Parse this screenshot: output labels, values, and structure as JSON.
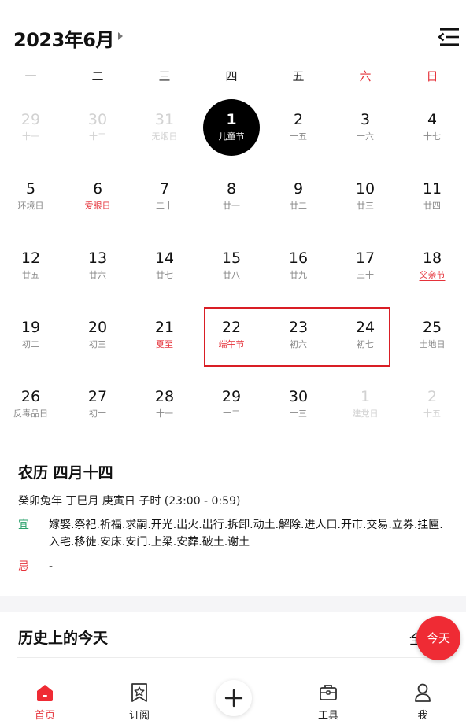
{
  "header": {
    "title": "2023年6月",
    "menu_icon": "collapse-menu-icon"
  },
  "weekdays": [
    {
      "label": "一",
      "weekend": false
    },
    {
      "label": "二",
      "weekend": false
    },
    {
      "label": "三",
      "weekend": false
    },
    {
      "label": "四",
      "weekend": false
    },
    {
      "label": "五",
      "weekend": false
    },
    {
      "label": "六",
      "weekend": true
    },
    {
      "label": "日",
      "weekend": true
    }
  ],
  "calendar": {
    "rows": [
      [
        {
          "day": "29",
          "sub": "十一",
          "dim": true
        },
        {
          "day": "30",
          "sub": "十二",
          "dim": true
        },
        {
          "day": "31",
          "sub": "无烟日",
          "dim": true
        },
        {
          "day": "1",
          "sub": "儿童节",
          "today": true
        },
        {
          "day": "2",
          "sub": "十五"
        },
        {
          "day": "3",
          "sub": "十六"
        },
        {
          "day": "4",
          "sub": "十七"
        }
      ],
      [
        {
          "day": "5",
          "sub": "环境日"
        },
        {
          "day": "6",
          "sub": "爱眼日",
          "red": true
        },
        {
          "day": "7",
          "sub": "二十"
        },
        {
          "day": "8",
          "sub": "廿一"
        },
        {
          "day": "9",
          "sub": "廿二"
        },
        {
          "day": "10",
          "sub": "廿三"
        },
        {
          "day": "11",
          "sub": "廿四"
        }
      ],
      [
        {
          "day": "12",
          "sub": "廿五"
        },
        {
          "day": "13",
          "sub": "廿六"
        },
        {
          "day": "14",
          "sub": "廿七"
        },
        {
          "day": "15",
          "sub": "廿八"
        },
        {
          "day": "16",
          "sub": "廿九"
        },
        {
          "day": "17",
          "sub": "三十"
        },
        {
          "day": "18",
          "sub": "父亲节",
          "red": true,
          "underline": true
        }
      ],
      [
        {
          "day": "19",
          "sub": "初二"
        },
        {
          "day": "20",
          "sub": "初三"
        },
        {
          "day": "21",
          "sub": "夏至",
          "red": true
        },
        {
          "day": "22",
          "sub": "端午节",
          "red": true
        },
        {
          "day": "23",
          "sub": "初六"
        },
        {
          "day": "24",
          "sub": "初七"
        },
        {
          "day": "25",
          "sub": "土地日"
        }
      ],
      [
        {
          "day": "26",
          "sub": "反毒品日"
        },
        {
          "day": "27",
          "sub": "初十"
        },
        {
          "day": "28",
          "sub": "十一"
        },
        {
          "day": "29",
          "sub": "十二"
        },
        {
          "day": "30",
          "sub": "十三"
        },
        {
          "day": "1",
          "sub": "建党日",
          "dim": true
        },
        {
          "day": "2",
          "sub": "十五",
          "dim": true
        }
      ]
    ]
  },
  "lunar": {
    "title": "农历 四月十四",
    "ganzhi": "癸卯兔年 丁巳月 庚寅日 子时 (23:00 - 0:59)",
    "yi_label": "宜",
    "yi_text": "嫁娶.祭祀.祈福.求嗣.开光.出火.出行.拆卸.动土.解除.进人口.开市.交易.立券.挂匾.入宅.移徙.安床.安门.上梁.安葬.破土.谢土",
    "ji_label": "忌",
    "ji_text": "-"
  },
  "history": {
    "title": "历史上的今天",
    "all_label": "全"
  },
  "fab": {
    "label": "今天"
  },
  "tabbar": {
    "tabs": [
      {
        "label": "首页",
        "icon": "home-icon",
        "active": true
      },
      {
        "label": "订阅",
        "icon": "bookmark-star-icon"
      },
      {
        "label": "",
        "icon": "plus-icon"
      },
      {
        "label": "工具",
        "icon": "toolbox-icon"
      },
      {
        "label": "我",
        "icon": "user-icon"
      }
    ]
  },
  "colors": {
    "accent": "#e5323a",
    "fab": "#ef2b34",
    "yi": "#2aa16b",
    "dim": "#d2d2d2"
  }
}
